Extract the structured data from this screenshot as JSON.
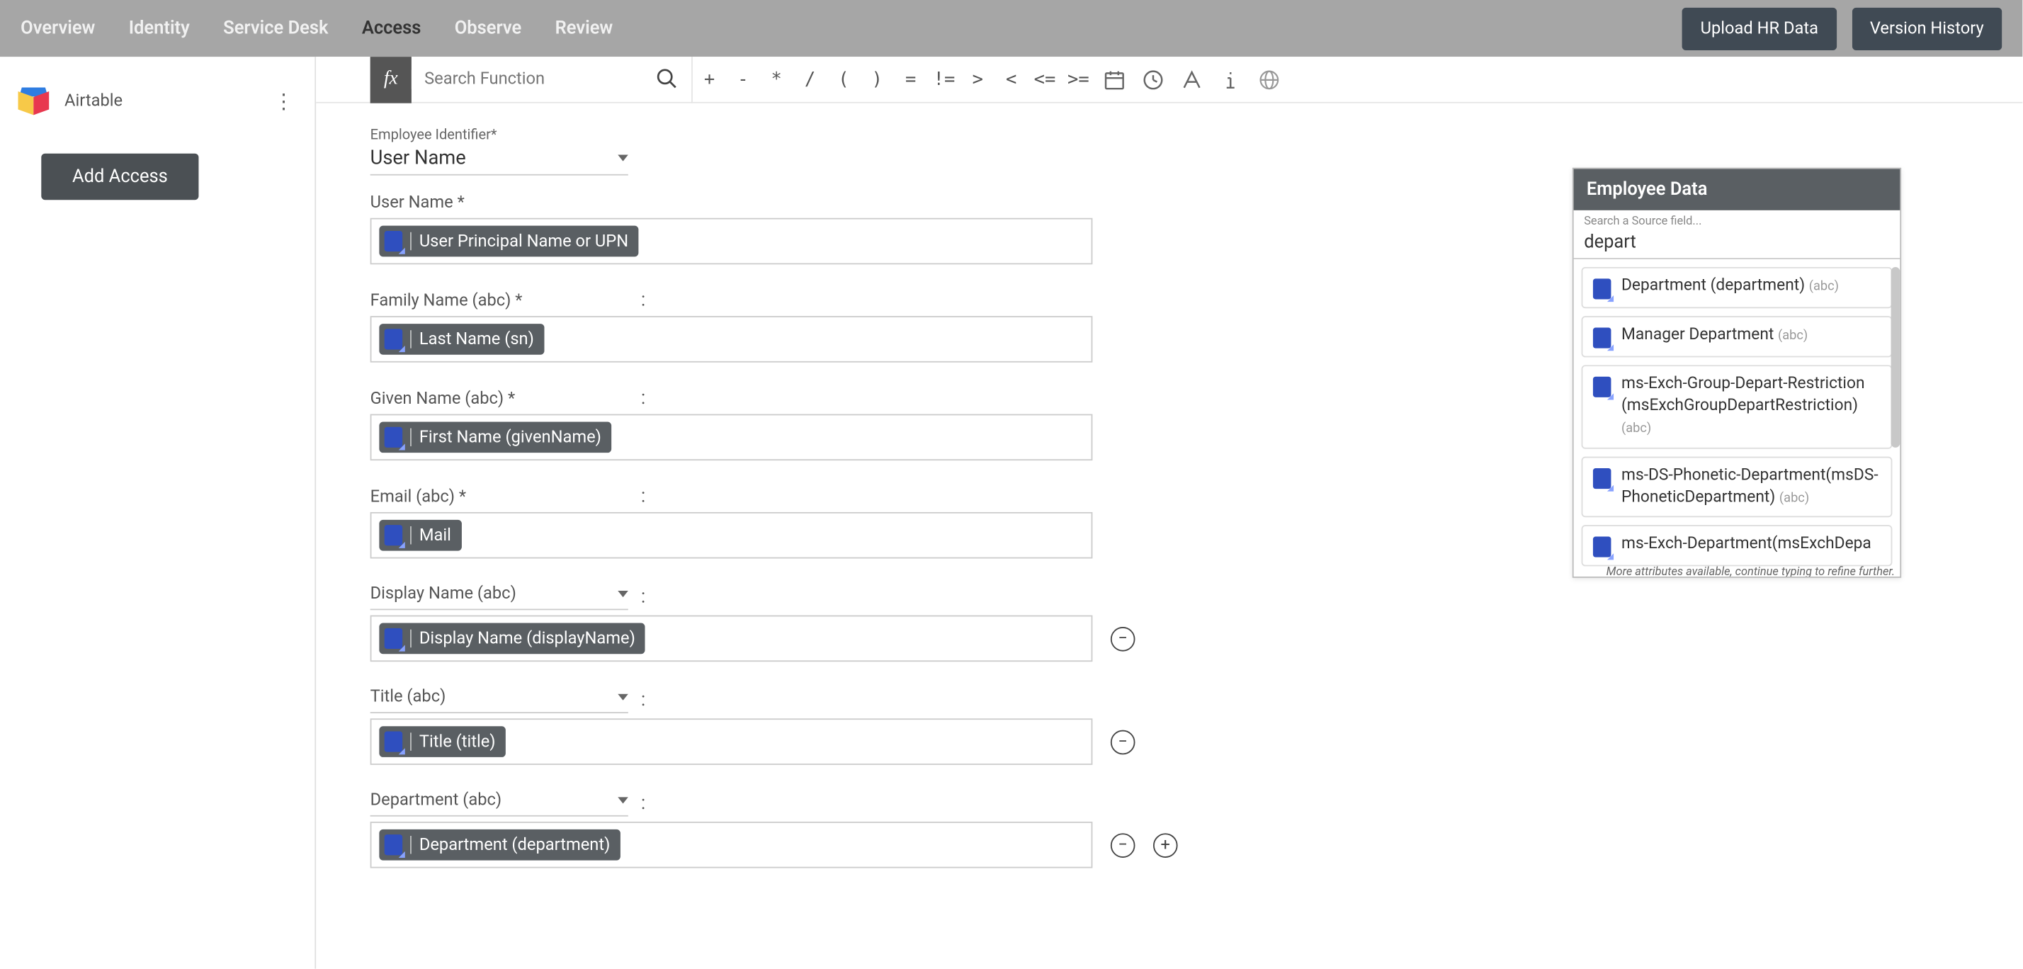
{
  "topbar": {
    "tabs": [
      "Overview",
      "Identity",
      "Service Desk",
      "Access",
      "Observe",
      "Review"
    ],
    "active": "Access",
    "upload": "Upload HR Data",
    "version": "Version History"
  },
  "sidebar": {
    "source": "Airtable",
    "add": "Add Access"
  },
  "formula": {
    "search_ph": "Search Function",
    "ops": [
      "+",
      "-",
      "*",
      "/",
      "(",
      ")",
      "=",
      "!=",
      ">",
      "<",
      "<=",
      ">="
    ]
  },
  "emp_id": {
    "label": "Employee Identifier*",
    "value": "User Name"
  },
  "fields": [
    {
      "label": "User Name *",
      "dropdown": false,
      "chip": "User Principal Name or UPN",
      "remove": false,
      "add": false
    },
    {
      "label": "Family Name (abc) *",
      "dropdown": false,
      "chip": "Last Name (sn)",
      "colon": true,
      "remove": false,
      "add": false
    },
    {
      "label": "Given Name (abc) *",
      "dropdown": false,
      "chip": "First Name (givenName)",
      "colon": true,
      "remove": false,
      "add": false
    },
    {
      "label": "Email (abc) *",
      "dropdown": false,
      "chip": "Mail",
      "colon": true,
      "remove": false,
      "add": false
    },
    {
      "label": "Display Name (abc)",
      "dropdown": true,
      "chip": "Display Name (displayName)",
      "colon": true,
      "remove": true,
      "add": false
    },
    {
      "label": "Title (abc)",
      "dropdown": true,
      "chip": "Title (title)",
      "colon": true,
      "remove": true,
      "add": false
    },
    {
      "label": "Department (abc)",
      "dropdown": true,
      "chip": "Department (department)",
      "colon": true,
      "remove": true,
      "add": true
    }
  ],
  "panel": {
    "title": "Employee Data",
    "search_ph": "Search a Source field...",
    "search_val": "depart",
    "results": [
      {
        "t": "Department (department)",
        "type": "(abc)"
      },
      {
        "t": "Manager Department",
        "type": "(abc)"
      },
      {
        "t": "ms-Exch-Group-Depart-Restriction (msExchGroupDepartRestriction)",
        "type": "(abc)"
      },
      {
        "t": "ms-DS-Phonetic-Department(msDS-PhoneticDepartment)",
        "type": "(abc)"
      },
      {
        "t": "ms-Exch-Department(msExchDepa",
        "type": ""
      }
    ],
    "more": "More attributes available, continue typing to refine further."
  }
}
